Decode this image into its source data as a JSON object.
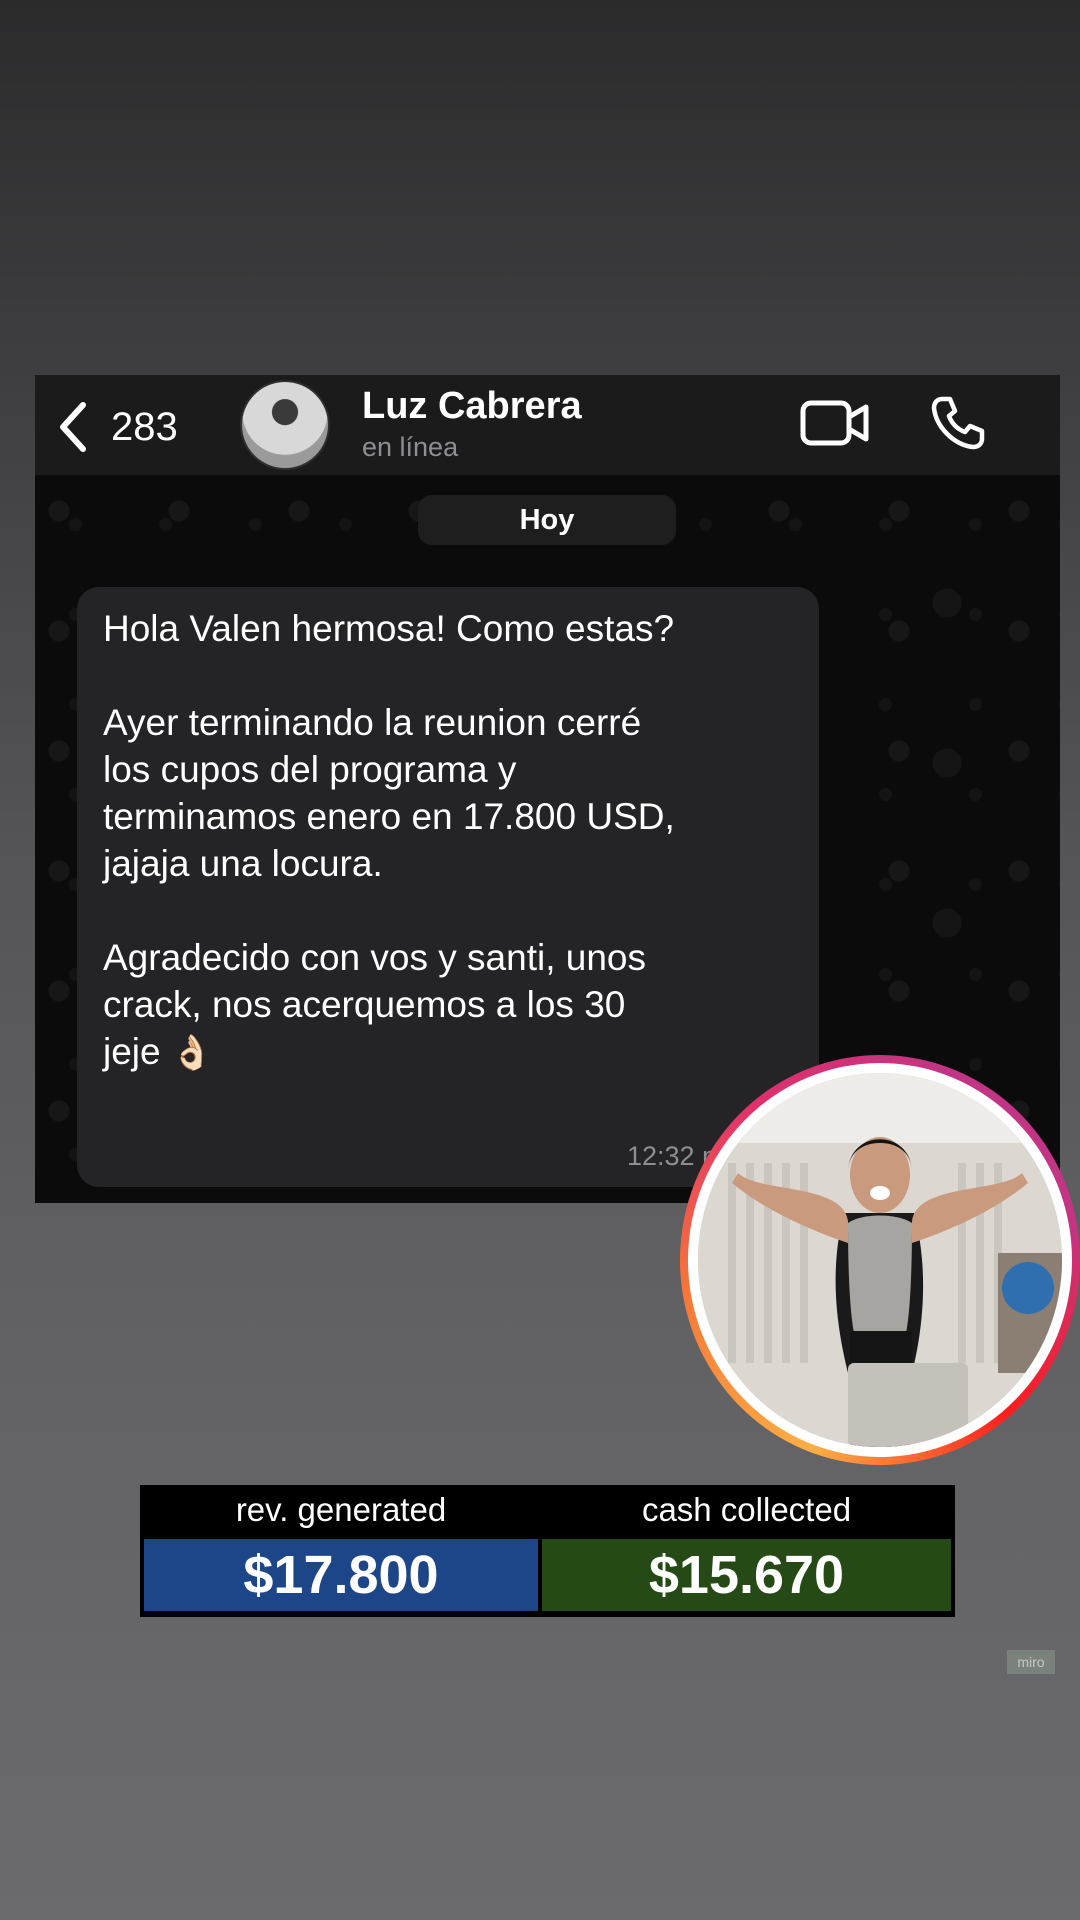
{
  "header": {
    "back_count": "283",
    "contact_name": "Luz Cabrera",
    "contact_status": "en línea"
  },
  "chat": {
    "date_label": "Hoy",
    "message": {
      "lines": [
        "Hola Valen hermosa! Como estas?",
        "",
        "Ayer terminando la reunion cerré",
        "los cupos del programa y",
        "terminamos enero en 17.800 USD,",
        "jajaja una locura.",
        "",
        "Agradecido con vos y santi, unos",
        "crack, nos acerquemos a los 30",
        "jeje"
      ],
      "emoji": "👌🏻",
      "time": "12:32 p"
    }
  },
  "stats": {
    "revenue_label": "rev. generated",
    "revenue_value": "$17.800",
    "cash_label": "cash collected",
    "cash_value": "$15.670",
    "revenue_color": "#1d4689",
    "cash_color": "#264a16"
  },
  "watermark": "miro",
  "icons": [
    "chevron-left-icon",
    "video-camera-icon",
    "phone-icon"
  ]
}
